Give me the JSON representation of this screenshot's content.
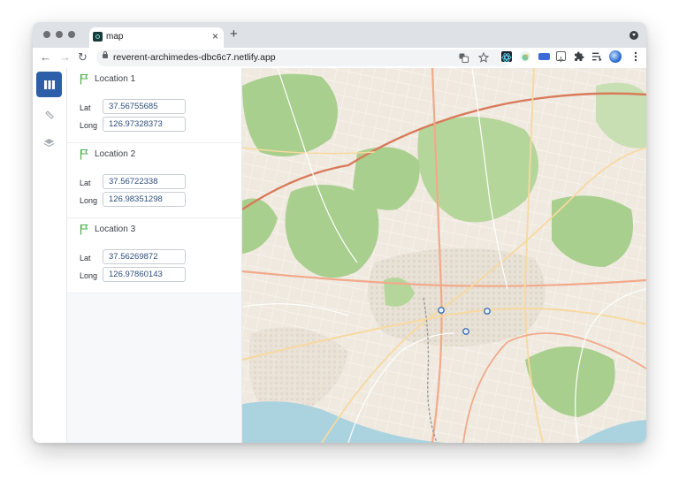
{
  "browser": {
    "tab": {
      "title": "map",
      "close_glyph": "×",
      "favicon": "react-icon"
    },
    "new_tab_glyph": "+",
    "url": "reverent-archimedes-dbc6c7.netlify.app",
    "nav": {
      "back": "←",
      "forward": "→",
      "reload": "↻"
    },
    "omnibox_icons": [
      "translate-icon",
      "star-icon"
    ],
    "extensions": [
      "react-devtools-icon",
      "extension-green-icon",
      "extension-blue-icon",
      "download-icon",
      "puzzle-icon",
      "reading-list-icon",
      "profile-avatar-icon",
      "more-icon"
    ]
  },
  "rail": {
    "items": [
      {
        "icon": "map-icon",
        "active": true
      },
      {
        "icon": "ruler-icon",
        "active": false
      },
      {
        "icon": "layers-icon",
        "active": false
      }
    ]
  },
  "locations": [
    {
      "title": "Location 1",
      "lat_label": "Lat",
      "long_label": "Long",
      "lat": "37.56755685",
      "long": "126.97328373"
    },
    {
      "title": "Location 2",
      "lat_label": "Lat",
      "long_label": "Long",
      "lat": "37.56722338",
      "long": "126.98351298"
    },
    {
      "title": "Location 3",
      "lat_label": "Lat",
      "long_label": "Long",
      "lat": "37.56269872",
      "long": "126.97860143"
    }
  ],
  "colors": {
    "accent": "#2c5fa8",
    "flag": "#4caf50",
    "map_park": "#a8cf8d",
    "map_land": "#efe9df",
    "map_water": "#aad3df",
    "map_road_major": "#f2a98b",
    "map_road_minor": "#f7d9a0"
  }
}
